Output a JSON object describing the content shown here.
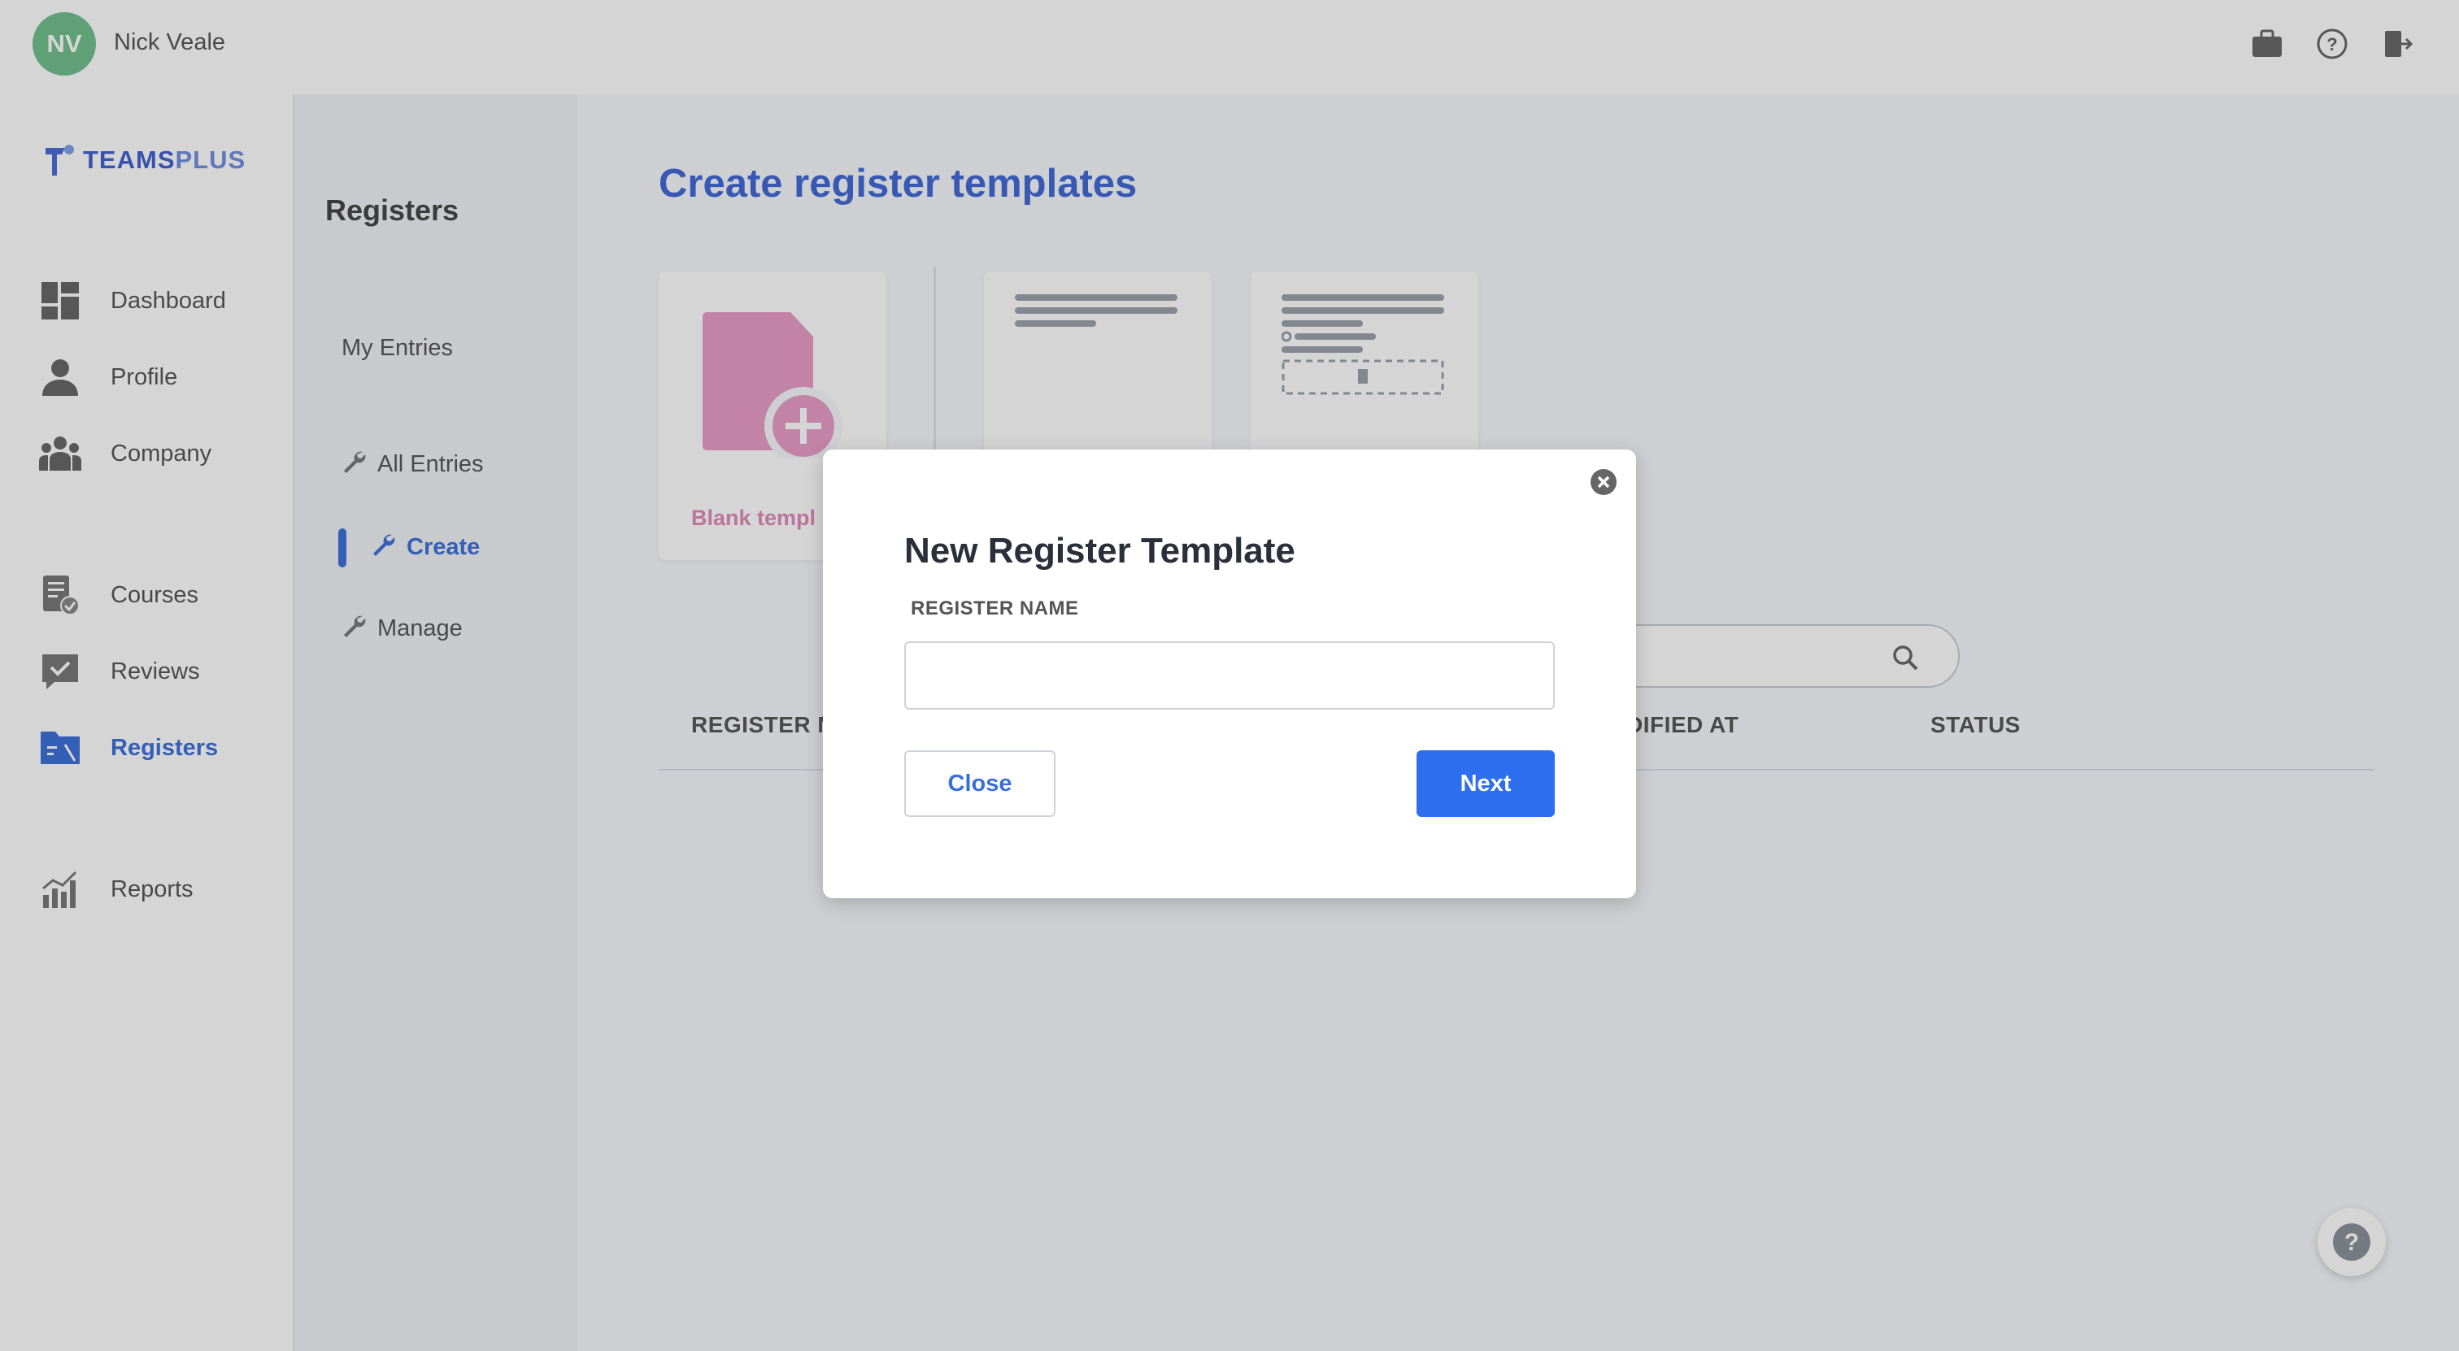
{
  "topbar": {
    "avatar_initials": "NV",
    "user_name": "Nick Veale",
    "icons": [
      "briefcase-icon",
      "help-circle-icon",
      "logout-icon"
    ]
  },
  "logo": {
    "part1": "TEAMS",
    "part2": "PLUS"
  },
  "nav": {
    "items": [
      {
        "label": "Dashboard",
        "icon": "dashboard-icon"
      },
      {
        "label": "Profile",
        "icon": "user-icon"
      },
      {
        "label": "Company",
        "icon": "team-icon"
      },
      {
        "label": "Courses",
        "icon": "courses-icon"
      },
      {
        "label": "Reviews",
        "icon": "reviews-icon"
      },
      {
        "label": "Registers",
        "icon": "registers-icon"
      },
      {
        "label": "Reports",
        "icon": "reports-icon"
      }
    ],
    "active": "Registers"
  },
  "subnav": {
    "title": "Registers",
    "items": [
      {
        "label": "My Entries"
      },
      {
        "label": "All Entries",
        "icon": "wrench-icon"
      },
      {
        "label": "Create",
        "icon": "wrench-icon"
      },
      {
        "label": "Manage",
        "icon": "wrench-icon"
      }
    ],
    "active": "Create"
  },
  "main": {
    "title": "Create register templates",
    "cards": [
      {
        "label": "Blank templ"
      }
    ],
    "table": {
      "headers": [
        "REGISTER N",
        "DIFIED AT",
        "STATUS"
      ]
    }
  },
  "modal": {
    "title": "New Register Template",
    "field_label": "REGISTER NAME",
    "field_value": "",
    "close_label": "Close",
    "next_label": "Next"
  },
  "colors": {
    "accent": "#2d6fef",
    "brand": "#3f68d6",
    "avatar": "#6fbf8b",
    "blank_card": "#e89cc6"
  }
}
